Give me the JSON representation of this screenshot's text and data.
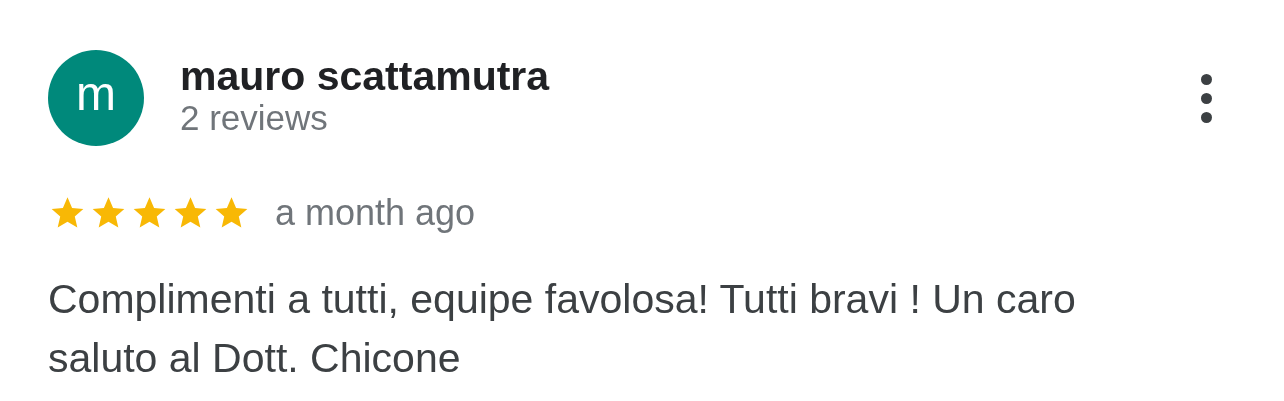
{
  "review": {
    "avatar_letter": "m",
    "author": "mauro scattamutra",
    "review_count": "2 reviews",
    "stars": 5,
    "time": "a month ago",
    "text": "Complimenti a tutti, equipe favolosa! Tutti bravi ! Un caro saluto al Dott. Chicone"
  }
}
